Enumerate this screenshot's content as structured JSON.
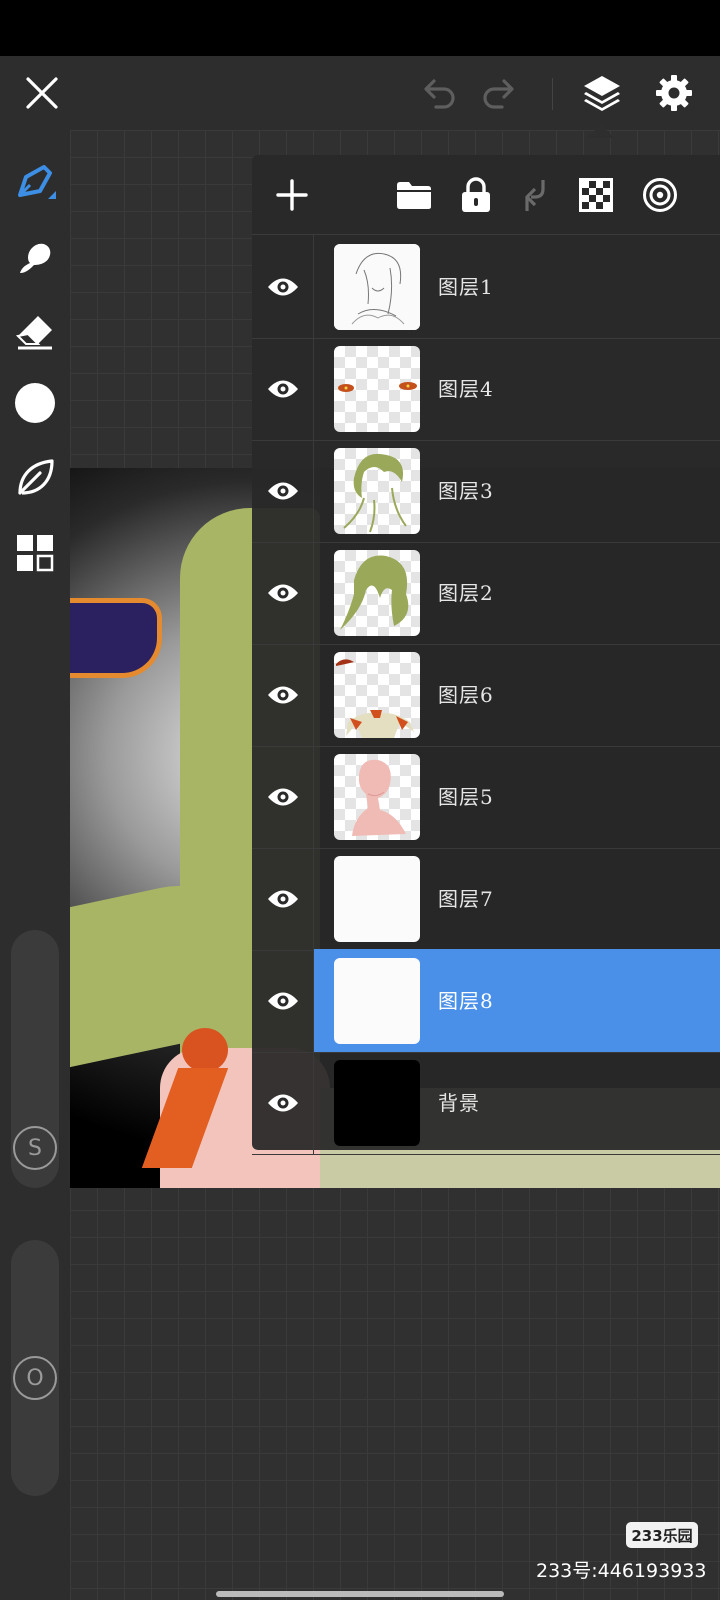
{
  "top_bar": {
    "icons": [
      "close-icon",
      "undo-icon",
      "redo-icon",
      "layers-icon",
      "settings-icon"
    ]
  },
  "side_tools": {
    "icons": [
      "brush-icon",
      "smudge-icon",
      "eraser-icon",
      "color-circle-icon",
      "leaf-icon",
      "grid-icon"
    ],
    "active_color": "#ffffff",
    "accent": "#3d8fe6",
    "size_slider_label": "S",
    "opacity_slider_label": "O"
  },
  "layer_panel": {
    "toolbar_icons": [
      "add-icon",
      "folder-icon",
      "lock-icon",
      "merge-down-icon",
      "transparency-icon",
      "circle-target-icon"
    ],
    "selected_color": "#4a90e8",
    "layers": [
      {
        "name": "图层1",
        "visible": true,
        "selected": false
      },
      {
        "name": "图层4",
        "visible": true,
        "selected": false
      },
      {
        "name": "图层3",
        "visible": true,
        "selected": false
      },
      {
        "name": "图层2",
        "visible": true,
        "selected": false
      },
      {
        "name": "图层6",
        "visible": true,
        "selected": false
      },
      {
        "name": "图层5",
        "visible": true,
        "selected": false
      },
      {
        "name": "图层7",
        "visible": true,
        "selected": false
      },
      {
        "name": "图层8",
        "visible": true,
        "selected": true
      },
      {
        "name": "背景",
        "visible": true,
        "selected": false
      }
    ]
  },
  "watermark": {
    "logo": "233乐园",
    "text": "233号:446193933"
  }
}
